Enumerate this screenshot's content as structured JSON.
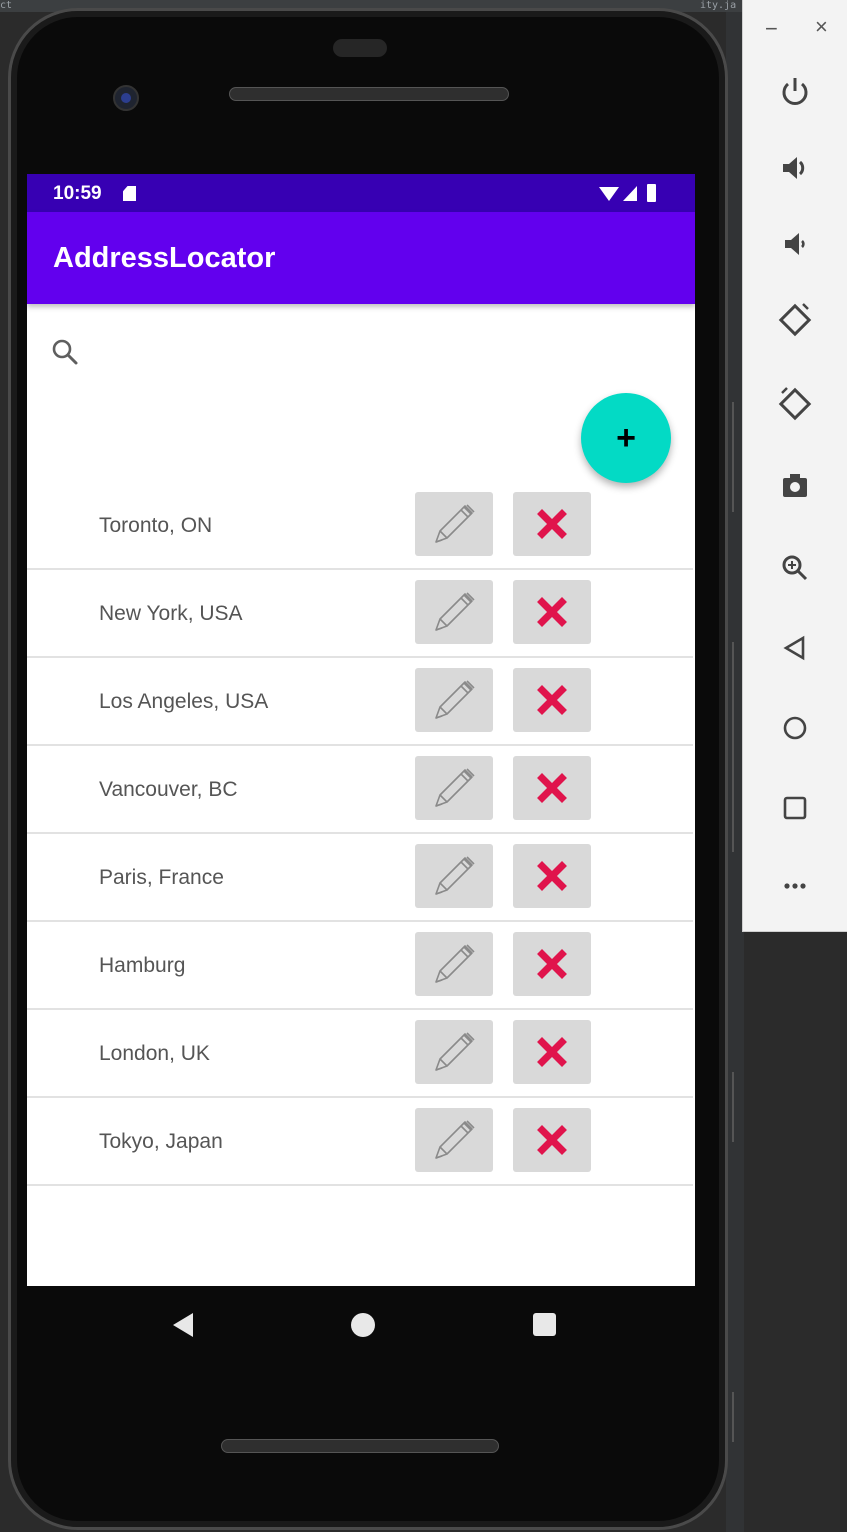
{
  "app": {
    "title": "AddressLocator",
    "status_time": "10:59"
  },
  "fab_label": "+",
  "addresses": [
    "Toronto, ON",
    "New York, USA",
    "Los Angeles, USA",
    "Vancouver, BC",
    "Paris, France",
    "Hamburg",
    "London, UK",
    "Tokyo, Japan"
  ],
  "icons": {
    "search": "search-icon",
    "edit": "pencil-icon",
    "delete": "x-icon"
  },
  "colors": {
    "status_bar": "#3700b3",
    "app_bar": "#6200ee",
    "fab": "#03dac5",
    "delete": "#e0144c",
    "button_bg": "#d9d9d9"
  },
  "toolbar": {
    "minimize": "−",
    "close": "×"
  }
}
